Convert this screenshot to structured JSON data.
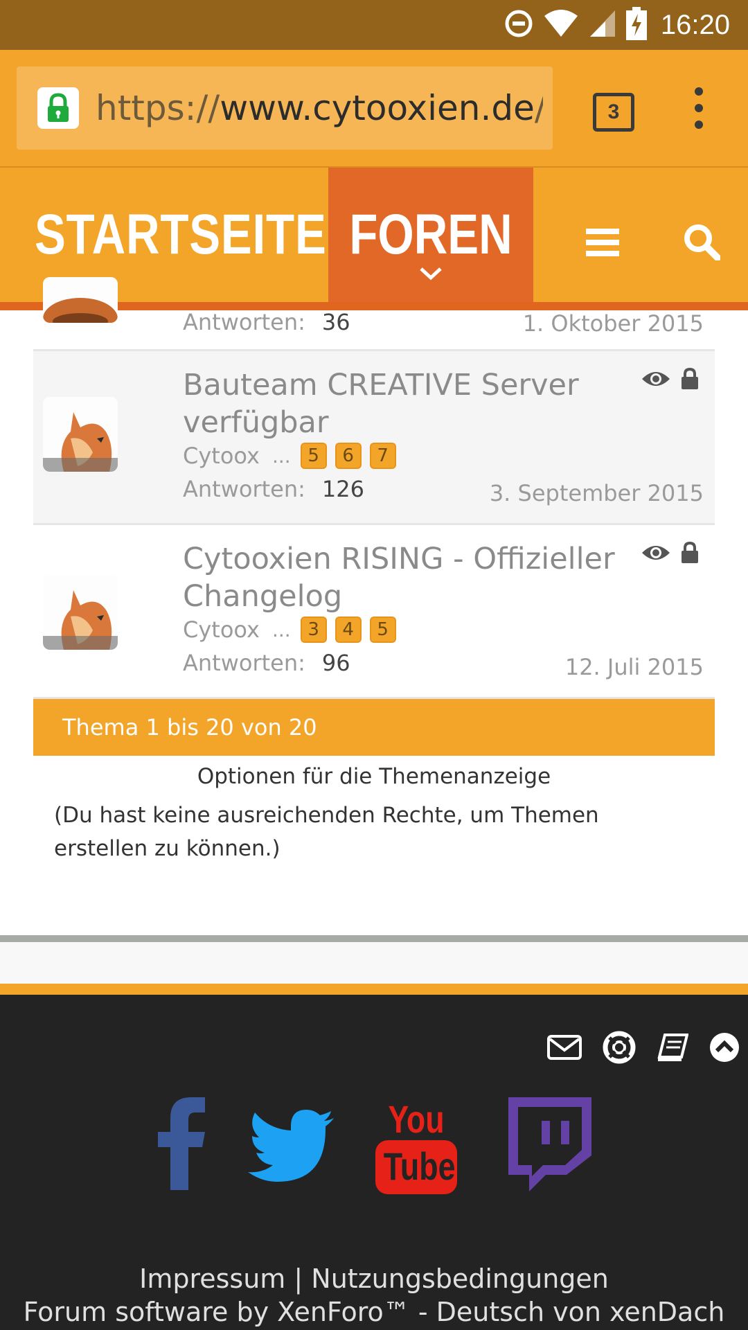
{
  "status": {
    "time": "16:20"
  },
  "browser": {
    "url_scheme": "https://",
    "url_host": "www.cytooxien.de",
    "url_rest": "/fo",
    "tab_count": "3"
  },
  "nav": {
    "home": "STARTSEITE",
    "forums": "FOREN"
  },
  "threads": {
    "partial": {
      "replies_label": "Antworten:",
      "replies": "36",
      "date": "1. Oktober 2015"
    },
    "items": [
      {
        "title": "Bauteam CREATIVE Server verfügbar",
        "author": "Cytoox",
        "ellipsis": "...",
        "pages": [
          "5",
          "6",
          "7"
        ],
        "replies_label": "Antworten:",
        "replies": "126",
        "date": "3. September 2015"
      },
      {
        "title": "Cytooxien RISING - Offizieller Changelog",
        "author": "Cytoox",
        "ellipsis": "...",
        "pages": [
          "3",
          "4",
          "5"
        ],
        "replies_label": "Antworten:",
        "replies": "96",
        "date": "12. Juli 2015"
      }
    ]
  },
  "pager": {
    "text": "Thema 1 bis 20 von 20"
  },
  "options": {
    "label": "Optionen für die Themenanzeige"
  },
  "notice": {
    "text": "(Du hast keine ausreichenden Rechte, um Themen erstellen zu können.)"
  },
  "footer": {
    "social": {
      "youtube_top": "You",
      "youtube_bottom": "Tube"
    },
    "impressum": "Impressum",
    "divider": " | ",
    "terms": "Nutzungsbedingungen",
    "credit": "Forum software by XenForo™ - Deutsch von xenDach"
  },
  "colors": {
    "brand_orange": "#f3a52a",
    "active_tab": "#e16827",
    "status_bar": "#94631b",
    "footer_bg": "#232323"
  }
}
